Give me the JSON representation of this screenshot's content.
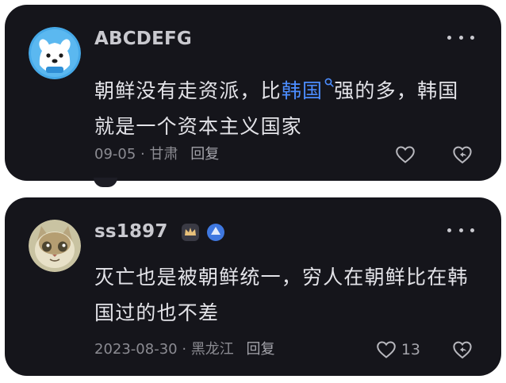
{
  "comments": [
    {
      "username": "ABCDEFG",
      "text_before": "朝鲜没有走资派，比",
      "link_text": "韩国",
      "text_after": "强的多，韩国就是一个资本主义国家",
      "date": "09-05",
      "separator": "·",
      "location": "甘肃",
      "reply_label": "回复",
      "like_count": "",
      "avatar_icon": "dog-avatar",
      "accent": "#4c8dff"
    },
    {
      "username": "ss1897",
      "text": "灭亡也是被朝鲜统一，穷人在朝鲜比在韩国过的也不差",
      "date": "2023-08-30",
      "separator": "·",
      "location": "黑龙江",
      "reply_label": "回复",
      "like_count": "13",
      "avatar_icon": "cat-avatar",
      "badges": [
        "crown-badge",
        "level-badge"
      ]
    }
  ],
  "colors": {
    "card_bg": "#15151b",
    "text": "#e3e3e8",
    "meta": "#8b8b92",
    "link": "#4c8dff",
    "badge_blue": "#3f78e0"
  }
}
